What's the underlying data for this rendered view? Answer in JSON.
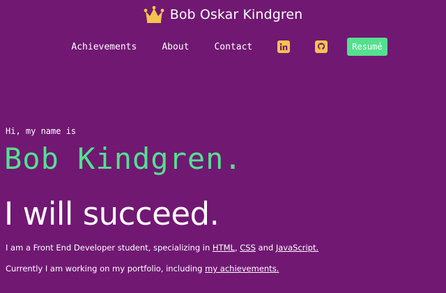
{
  "brand": {
    "name": "Bob Oskar Kindgren",
    "icon": "crown-icon",
    "icon_color": "#f4c451"
  },
  "nav": {
    "links": [
      "Achievements",
      "About",
      "Contact"
    ],
    "linkedin_icon": "linkedin-icon",
    "github_icon": "github-icon",
    "resume_label": "Resumé"
  },
  "hero": {
    "greeting": "Hi, my name is",
    "name": "Bob Kindgren.",
    "tagline": "I will succeed.",
    "intro": {
      "prefix": "I am a Front End Developer student, specializing in ",
      "skill1": "HTML",
      "sep1": ", ",
      "skill2": "CSS",
      "sep2": " and ",
      "skill3": "JavaScript."
    },
    "current": {
      "prefix": "Currently I am working on my portfolio, including ",
      "link": "my achievements."
    }
  },
  "colors": {
    "background": "#711873",
    "accent_green": "#54e08f",
    "accent_yellow": "#f4c451",
    "text": "#ffffff"
  }
}
